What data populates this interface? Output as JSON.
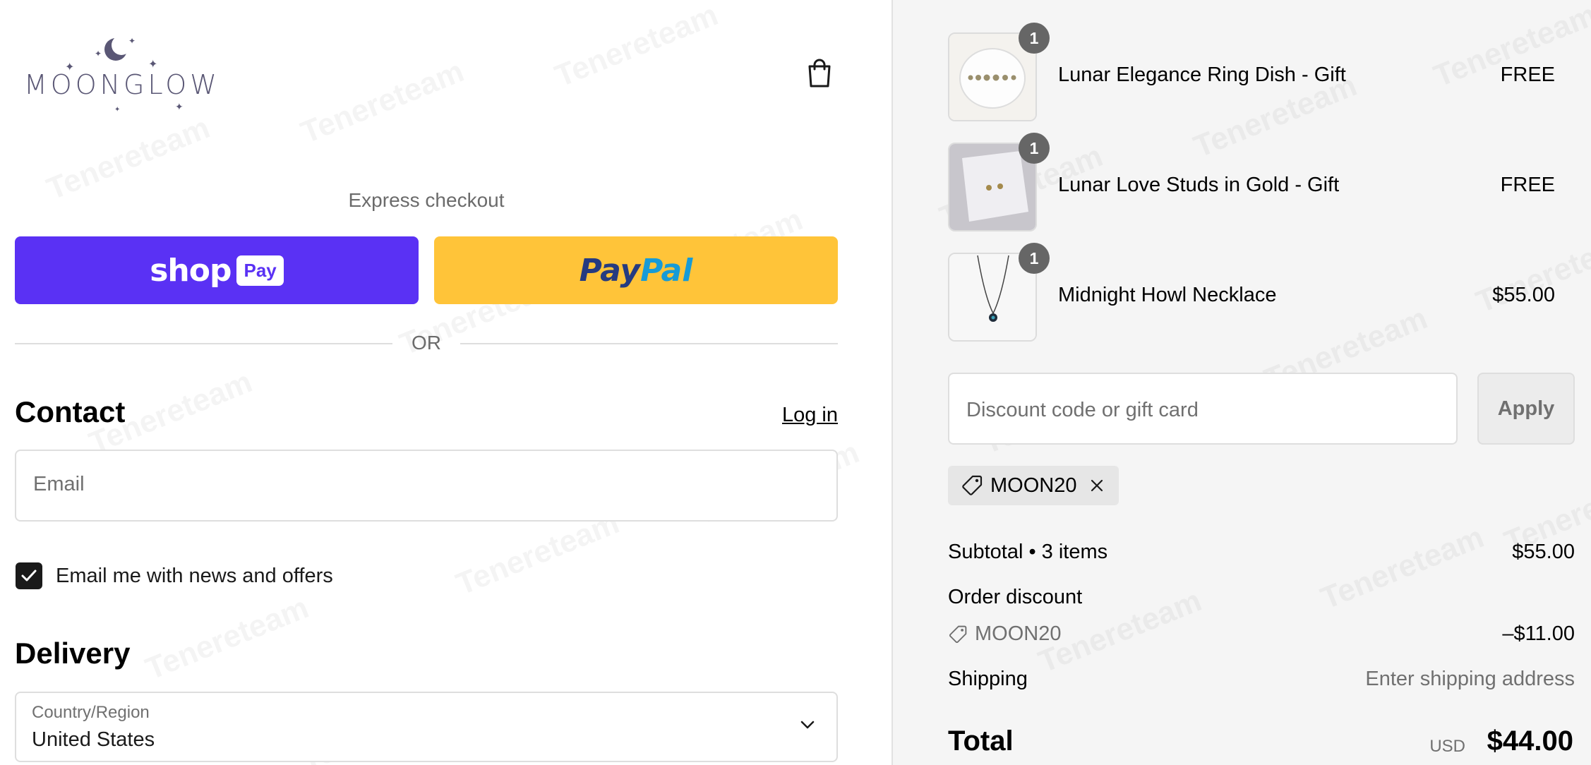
{
  "brand": {
    "logo_text": "MOONGLOW"
  },
  "header": {
    "cart_icon": "shopping-bag-icon"
  },
  "express": {
    "label": "Express checkout",
    "shop_word": "shop",
    "shop_pill": "Pay",
    "paypal_part1": "Pay",
    "paypal_part2": "Pal",
    "or_text": "OR"
  },
  "contact": {
    "heading": "Contact",
    "login_link": "Log in",
    "email_placeholder": "Email",
    "newsletter_label": "Email me with news and offers",
    "newsletter_checked": true
  },
  "delivery": {
    "heading": "Delivery",
    "country_label": "Country/Region",
    "country_value": "United States"
  },
  "cart": {
    "items": [
      {
        "name": "Lunar Elegance Ring Dish - Gift",
        "price": "FREE",
        "qty": "1"
      },
      {
        "name": "Lunar Love Studs in Gold - Gift",
        "price": "FREE",
        "qty": "1"
      },
      {
        "name": "Midnight Howl Necklace",
        "price": "$55.00",
        "qty": "1"
      }
    ]
  },
  "discount": {
    "placeholder": "Discount code or gift card",
    "apply_label": "Apply",
    "applied_code": "MOON20"
  },
  "summary": {
    "subtotal_label": "Subtotal • 3 items",
    "subtotal_value": "$55.00",
    "order_discount_label": "Order discount",
    "discount_code": "MOON20",
    "discount_value": "–$11.00",
    "shipping_label": "Shipping",
    "shipping_value": "Enter shipping address",
    "total_label": "Total",
    "currency": "USD",
    "total_value": "$44.00"
  },
  "colors": {
    "shop_pay": "#5a31f4",
    "paypal": "#ffc439",
    "paypal_dark": "#253b80",
    "paypal_light": "#179bd7",
    "logo": "#5a5775"
  }
}
